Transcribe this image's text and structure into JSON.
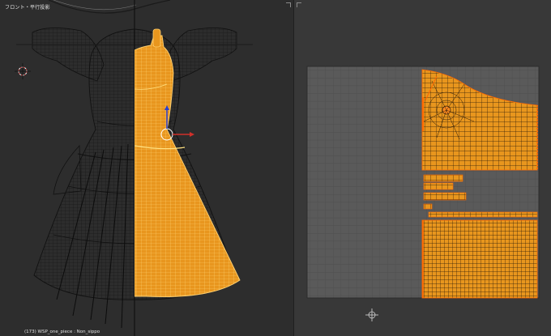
{
  "view3d": {
    "label": "フロント・平行投影",
    "status": "(173) WSP_one_piece : Non_sippo"
  },
  "colors": {
    "background": "#393939",
    "wire_dark": "#111111",
    "selected_fill": "#e8961e",
    "selected_wire": "#ffd070",
    "uv_canvas": "#5a5a5a",
    "uv_grid": "#4b4b4b",
    "vertex_select": "#ff6a00",
    "axis_x": "#d0302a",
    "axis_z": "#2a3fd0"
  },
  "icons": {
    "cursor_3d": "crosshair-icon",
    "cursor_2d": "crosshair-icon",
    "manipulator": "transform-manipulator-icon"
  }
}
